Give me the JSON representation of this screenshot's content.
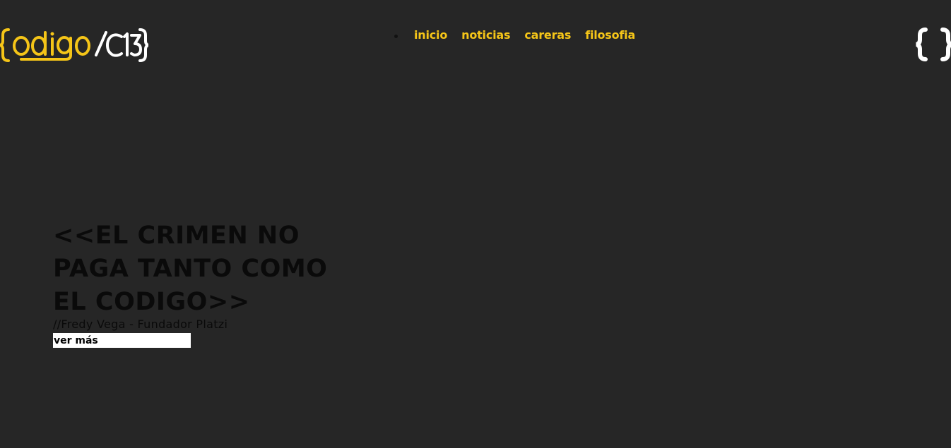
{
  "brand": {
    "logo_text_primary": "{odigo",
    "logo_text_secondary": "/C13}",
    "accent_color": "#f5c518",
    "logo_secondary_color": "#ffffff"
  },
  "nav": {
    "items": [
      {
        "label": "inicio"
      },
      {
        "label": "noticias"
      },
      {
        "label": "careras"
      },
      {
        "label": "filosofia"
      }
    ]
  },
  "header_icon": "braces-icon",
  "hero": {
    "quote": "<<EL CRIMEN NO\nPAGA TANTO COMO\nEL CODIGO>>",
    "author": "//Fredy Vega - Fundador Platzi",
    "cta_label": "ver más"
  },
  "colors": {
    "background": "#262626",
    "text_dark": "#0a0a0a",
    "button_bg": "#ffffff"
  }
}
